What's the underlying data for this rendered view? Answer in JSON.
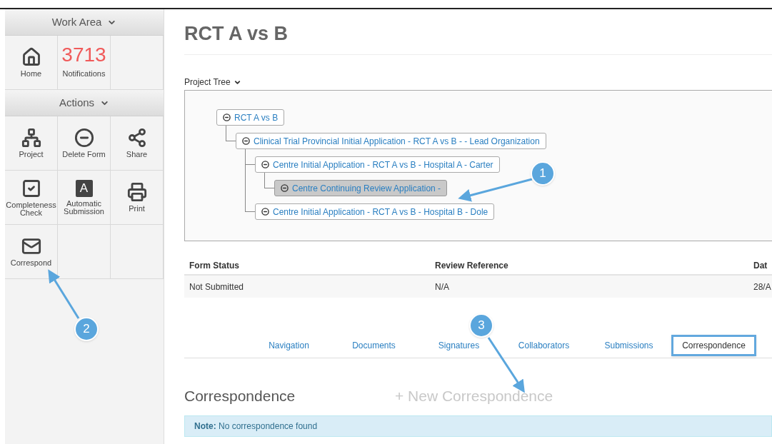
{
  "sidebar": {
    "sections": [
      {
        "title": "Work Area",
        "tiles": [
          {
            "kind": "icon",
            "label": "Home"
          },
          {
            "kind": "count",
            "count": "3713",
            "label": "Notifications"
          },
          {
            "kind": "empty"
          }
        ]
      },
      {
        "title": "Actions",
        "tiles": [
          {
            "kind": "icon",
            "label": "Project"
          },
          {
            "kind": "icon",
            "label": "Delete Form"
          },
          {
            "kind": "icon",
            "label": "Share"
          },
          {
            "kind": "icon",
            "label": "Completeness Check"
          },
          {
            "kind": "letter",
            "letter": "A",
            "label": "Automatic Submission"
          },
          {
            "kind": "icon",
            "label": "Print"
          },
          {
            "kind": "icon",
            "label": "Correspond"
          },
          {
            "kind": "empty"
          },
          {
            "kind": "empty"
          }
        ]
      }
    ]
  },
  "page": {
    "title": "RCT A vs B",
    "tree_label": "Project Tree",
    "tree": [
      {
        "label": "RCT A vs B",
        "selected": false,
        "children": [
          {
            "label": "Clinical Trial Provincial Initial Application - RCT A vs B - - Lead Organization",
            "selected": false,
            "children": [
              {
                "label": "Centre Initial Application - RCT A vs B - Hospital A - Carter",
                "selected": false,
                "children": [
                  {
                    "label": "Centre Continuing Review Application -",
                    "selected": true
                  }
                ]
              },
              {
                "label": "Centre Initial Application - RCT A vs B - Hospital B - Dole",
                "selected": false
              }
            ]
          }
        ]
      }
    ],
    "table": {
      "columns": [
        "Form Status",
        "Review Reference",
        "Dat"
      ],
      "rows": [
        [
          "Not Submitted",
          "N/A",
          "28/A"
        ]
      ]
    },
    "tabs": [
      {
        "label": "Navigation",
        "selected": false
      },
      {
        "label": "Documents",
        "selected": false
      },
      {
        "label": "Signatures",
        "selected": false
      },
      {
        "label": "Collaborators",
        "selected": false
      },
      {
        "label": "Submissions",
        "selected": false
      },
      {
        "label": "Correspondence",
        "selected": true
      }
    ],
    "section_title": "Correspondence",
    "new_link": "+ New Correspondence",
    "note": {
      "label": "Note:",
      "text": "No correspondence found"
    }
  },
  "callouts": [
    {
      "number": "1"
    },
    {
      "number": "2"
    },
    {
      "number": "3"
    }
  ]
}
